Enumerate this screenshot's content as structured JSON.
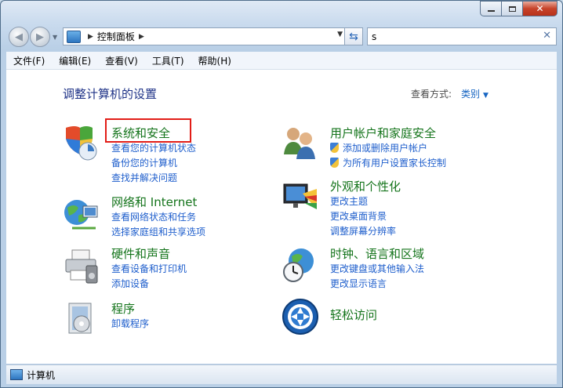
{
  "address": {
    "crumb": "控制面板"
  },
  "search": {
    "value": "s"
  },
  "menu": [
    "文件(F)",
    "编辑(E)",
    "查看(V)",
    "工具(T)",
    "帮助(H)"
  ],
  "page": {
    "heading": "调整计算机的设置",
    "view_by_label": "查看方式:",
    "view_by_value": "类别"
  },
  "categories": {
    "system": {
      "title": "系统和安全",
      "links": [
        "查看您的计算机状态",
        "备份您的计算机",
        "查找并解决问题"
      ]
    },
    "network": {
      "title": "网络和 Internet",
      "links": [
        "查看网络状态和任务",
        "选择家庭组和共享选项"
      ]
    },
    "hardware": {
      "title": "硬件和声音",
      "links": [
        "查看设备和打印机",
        "添加设备"
      ]
    },
    "programs": {
      "title": "程序",
      "links": [
        "卸载程序"
      ]
    },
    "users": {
      "title": "用户帐户和家庭安全",
      "links": [
        "添加或删除用户帐户",
        "为所有用户设置家长控制"
      ]
    },
    "appearance": {
      "title": "外观和个性化",
      "links": [
        "更改主题",
        "更改桌面背景",
        "调整屏幕分辨率"
      ]
    },
    "clock": {
      "title": "时钟、语言和区域",
      "links": [
        "更改键盘或其他输入法",
        "更改显示语言"
      ]
    },
    "ease": {
      "title": "轻松访问",
      "links": []
    }
  },
  "status": {
    "text": "计算机"
  },
  "icons": [
    "back-arrow-icon",
    "forward-arrow-icon",
    "refresh-icon",
    "shield-icon",
    "users-icon",
    "globe-network-icon",
    "monitor-paint-icon",
    "printer-icon",
    "globe-clock-icon",
    "programs-box-icon",
    "ease-of-access-icon",
    "computer-icon"
  ]
}
